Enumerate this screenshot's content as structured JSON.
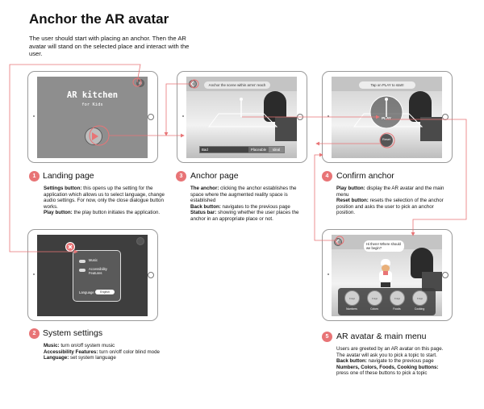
{
  "title": "Anchor the AR avatar",
  "intro": "The user should start with placing an anchor. Then the AR avatar will stand on the selected place and interact with the user.",
  "colors": {
    "accent": "#e87476",
    "dark_screen": "#3e3e3e",
    "landing_screen": "#8e8e8e"
  },
  "screens": {
    "landing": {
      "app_title": "AR kitchen",
      "subtitle": "for Kids"
    },
    "anchor": {
      "instruction": "Anchor the scene within arms' reach",
      "status": {
        "bad": "Bad",
        "placeable": "Placeable",
        "ideal": "Ideal"
      }
    },
    "confirm": {
      "instruction": "Tap on PLAY to start!",
      "play": "PLAY",
      "reset": "Reset"
    },
    "settings": {
      "music": "Music",
      "accessibility": "Accessibility Features",
      "language_label": "Language",
      "language_value": "English"
    },
    "menu": {
      "speech": "Hi there! Where should we begin?",
      "buttons": [
        {
          "icon": "Image",
          "label": "Numbers"
        },
        {
          "icon": "Image",
          "label": "Colors"
        },
        {
          "icon": "Image",
          "label": "Foods"
        },
        {
          "icon": "Image",
          "label": "Cooking"
        }
      ]
    }
  },
  "sections": [
    {
      "num": "1",
      "title": "Landing page",
      "lines": [
        {
          "b": "Settings button:",
          "t": " this opens up the setting for the application which allows us to select language, change audio settings. For now, only the close dialogue button works."
        },
        {
          "b": "Play button:",
          "t": " the play button initiates the application."
        }
      ]
    },
    {
      "num": "2",
      "title": "System settings",
      "lines": [
        {
          "b": "Music:",
          "t": " turn on/off system music"
        },
        {
          "b": "Accessibility Features:",
          "t": " turn on/off color blind mode"
        },
        {
          "b": "Language:",
          "t": " set system language"
        }
      ]
    },
    {
      "num": "3",
      "title": "Anchor page",
      "lines": [
        {
          "b": "The anchor:",
          "t": " clicking the anchor establishes the space where the augmented reality space is established"
        },
        {
          "b": "Back button:",
          "t": " navigates to the previous page"
        },
        {
          "b": "Status bar:",
          "t": " showing whether the user places the anchor in an appropriate place or not."
        }
      ]
    },
    {
      "num": "4",
      "title": "Confirm anchor",
      "lines": [
        {
          "b": "Play button:",
          "t": " display the AR avatar and the main menu"
        },
        {
          "b": "Reset button:",
          "t": " resets the selection of the anchor position and asks the user to pick an anchor position."
        }
      ]
    },
    {
      "num": "5",
      "title": "AR avatar & main menu",
      "lines": [
        {
          "b": "",
          "t": "Users are greeted by an AR avatar on this page. The avatar will ask you to pick a topic to start."
        },
        {
          "b": "Back button:",
          "t": " navigate to the previous page"
        },
        {
          "b": "Numbers, Colors, Foods, Cooking buttons:",
          "t": " press one of these buttons to pick a topic"
        }
      ]
    }
  ]
}
